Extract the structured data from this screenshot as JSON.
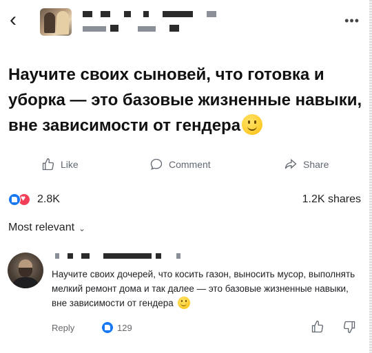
{
  "header": {
    "back_icon": "chevron-left-icon",
    "more_icon": "ellipsis-icon",
    "more_label": "•••"
  },
  "post": {
    "text": "Научите своих сыновей, что готовка и уборка — это базовые жизненные навыки, вне зависимости от гендера",
    "emoji": "smiling-face-emoji"
  },
  "actions": {
    "like_label": "Like",
    "comment_label": "Comment",
    "share_label": "Share"
  },
  "stats": {
    "reactions_count": "2.8K",
    "shares_label": "1.2K shares"
  },
  "comments_sort": {
    "label": "Most relevant"
  },
  "comment": {
    "text": "Научите своих дочерей, что косить газон, выносить мусор, выполнять мелкий ремонт дома и так далее — это базовые жизненные навыки, вне зависимости от гендера",
    "reply_label": "Reply",
    "likes": "129"
  },
  "colors": {
    "like_blue": "#1877f2",
    "love_red": "#f33e58",
    "meta_gray": "#65676b"
  }
}
